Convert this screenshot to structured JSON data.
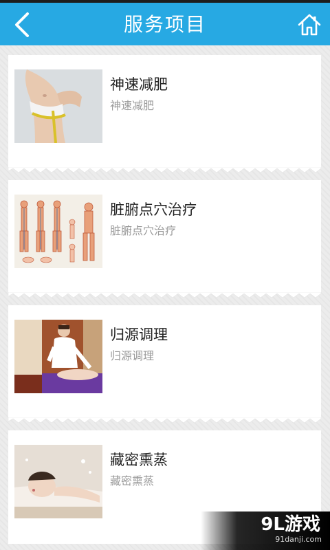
{
  "header": {
    "title": "服务项目",
    "back_icon": "chevron-left-icon",
    "home_icon": "home-icon",
    "bar_color": "#27a9e3"
  },
  "services": [
    {
      "name": "神速减肥",
      "subtitle": "神速减肥",
      "image": "waist-measuring-tape-photo"
    },
    {
      "name": "脏腑点穴治疗",
      "subtitle": "脏腑点穴治疗",
      "image": "acupoint-chart-photo"
    },
    {
      "name": "归源调理",
      "subtitle": "归源调理",
      "image": "massage-therapy-photo"
    },
    {
      "name": "藏密熏蒸",
      "subtitle": "藏密熏蒸",
      "image": "spa-relaxation-photo"
    }
  ],
  "watermark": {
    "logo": "9L游戏",
    "domain": "91danji.com"
  }
}
